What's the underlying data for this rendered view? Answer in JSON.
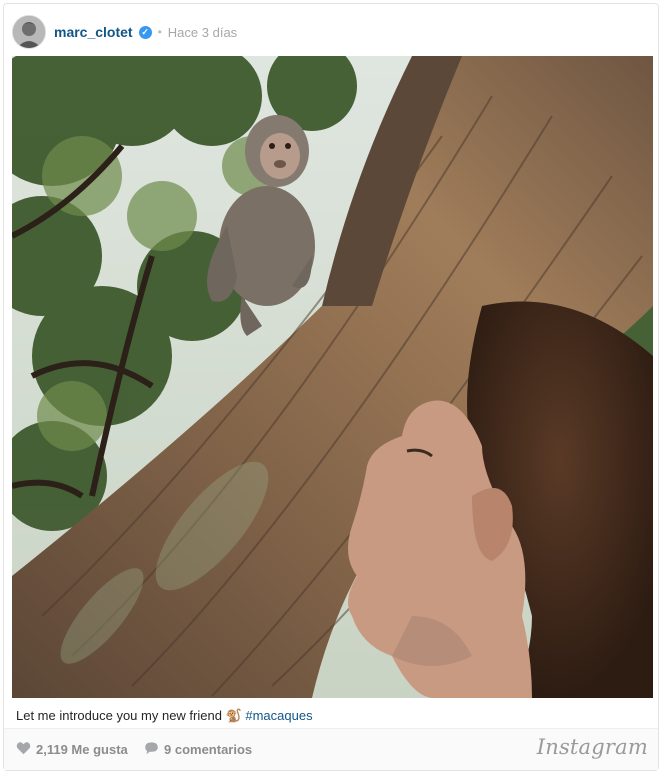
{
  "post": {
    "username": "marc_clotet",
    "separator": "•",
    "time_ago": "Hace 3 días",
    "caption_text": "Let me introduce you my new friend",
    "caption_emoji": "🐒",
    "hashtag": "#macaques"
  },
  "stats": {
    "likes": "2,119 Me gusta",
    "comments": "9 comentarios"
  },
  "brand": {
    "logo_text": "Instagram",
    "link_color": "#125688",
    "muted_color": "#a5a7aa"
  },
  "icons": [
    "verified-badge-icon",
    "heart-icon",
    "comment-bubble-icon"
  ]
}
